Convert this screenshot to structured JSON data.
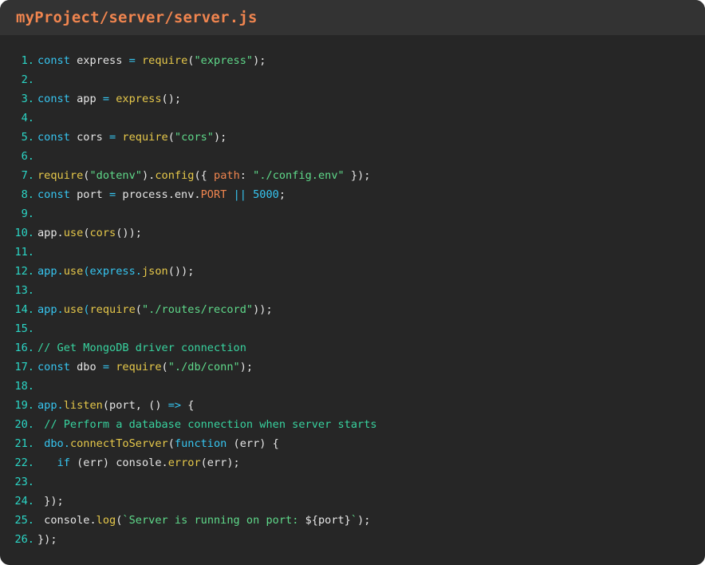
{
  "window": {
    "title": "myProject/server/server.js"
  },
  "colors": {
    "background": "#262626",
    "title_bar": "#333333",
    "title_text": "#f0854f",
    "line_number": "#2bd6c6",
    "keyword": "#36c5f0",
    "function": "#e6c84a",
    "string": "#5fd98a",
    "property": "#f0854f",
    "comment": "#38d39f",
    "default_text": "#e6e6e6"
  },
  "code": {
    "lines": [
      {
        "n": "1.",
        "tokens": [
          [
            "k",
            "const"
          ],
          [
            "d",
            " express "
          ],
          [
            "o",
            "="
          ],
          [
            "d",
            " "
          ],
          [
            "f",
            "require"
          ],
          [
            "d",
            "("
          ],
          [
            "s",
            "\"express\""
          ],
          [
            "d",
            ");"
          ]
        ]
      },
      {
        "n": "2.",
        "tokens": []
      },
      {
        "n": "3.",
        "tokens": [
          [
            "k",
            "const"
          ],
          [
            "d",
            " app "
          ],
          [
            "o",
            "="
          ],
          [
            "d",
            " "
          ],
          [
            "f",
            "express"
          ],
          [
            "d",
            "();"
          ]
        ]
      },
      {
        "n": "4.",
        "tokens": []
      },
      {
        "n": "5.",
        "tokens": [
          [
            "k",
            "const"
          ],
          [
            "d",
            " cors "
          ],
          [
            "o",
            "="
          ],
          [
            "d",
            " "
          ],
          [
            "f",
            "require"
          ],
          [
            "d",
            "("
          ],
          [
            "s",
            "\"cors\""
          ],
          [
            "d",
            ");"
          ]
        ]
      },
      {
        "n": "6.",
        "tokens": []
      },
      {
        "n": "7.",
        "tokens": [
          [
            "f",
            "require"
          ],
          [
            "d",
            "("
          ],
          [
            "s",
            "\"dotenv\""
          ],
          [
            "d",
            ")."
          ],
          [
            "f",
            "config"
          ],
          [
            "d",
            "({ "
          ],
          [
            "p",
            "path"
          ],
          [
            "d",
            ": "
          ],
          [
            "s",
            "\"./config.env\""
          ],
          [
            "d",
            " });"
          ]
        ]
      },
      {
        "n": "8.",
        "tokens": [
          [
            "k",
            "const"
          ],
          [
            "d",
            " port "
          ],
          [
            "o",
            "="
          ],
          [
            "d",
            " process.env."
          ],
          [
            "p",
            "PORT"
          ],
          [
            "d",
            " "
          ],
          [
            "o",
            "||"
          ],
          [
            "d",
            " "
          ],
          [
            "n",
            "5000"
          ],
          [
            "d",
            ";"
          ]
        ]
      },
      {
        "n": "9.",
        "tokens": []
      },
      {
        "n": "10.",
        "tokens": [
          [
            "d",
            "app."
          ],
          [
            "f",
            "use"
          ],
          [
            "d",
            "("
          ],
          [
            "f",
            "cors"
          ],
          [
            "d",
            "());"
          ]
        ]
      },
      {
        "n": "11.",
        "tokens": []
      },
      {
        "n": "12.",
        "tokens": [
          [
            "k",
            "app."
          ],
          [
            "f",
            "use"
          ],
          [
            "k",
            "(express."
          ],
          [
            "f",
            "json"
          ],
          [
            "d",
            "());"
          ]
        ]
      },
      {
        "n": "13.",
        "tokens": []
      },
      {
        "n": "14.",
        "tokens": [
          [
            "k",
            "app."
          ],
          [
            "f",
            "use"
          ],
          [
            "k",
            "("
          ],
          [
            "f",
            "require"
          ],
          [
            "d",
            "("
          ],
          [
            "s",
            "\"./routes/record\""
          ],
          [
            "d",
            "));"
          ]
        ]
      },
      {
        "n": "15.",
        "tokens": []
      },
      {
        "n": "16.",
        "tokens": [
          [
            "c",
            "// Get MongoDB driver connection"
          ]
        ]
      },
      {
        "n": "17.",
        "tokens": [
          [
            "k",
            "const"
          ],
          [
            "d",
            " dbo "
          ],
          [
            "o",
            "="
          ],
          [
            "d",
            " "
          ],
          [
            "f",
            "require"
          ],
          [
            "d",
            "("
          ],
          [
            "s",
            "\"./db/conn\""
          ],
          [
            "d",
            ");"
          ]
        ]
      },
      {
        "n": "18.",
        "tokens": []
      },
      {
        "n": "19.",
        "tokens": [
          [
            "k",
            "app."
          ],
          [
            "f",
            "listen"
          ],
          [
            "d",
            "(port, () "
          ],
          [
            "o",
            "=>"
          ],
          [
            "d",
            " {"
          ]
        ]
      },
      {
        "n": "20.",
        "tokens": [
          [
            "d",
            " "
          ],
          [
            "c",
            "// Perform a database connection when server starts"
          ]
        ]
      },
      {
        "n": "21.",
        "tokens": [
          [
            "d",
            " "
          ],
          [
            "k",
            "dbo."
          ],
          [
            "f",
            "connectToServer"
          ],
          [
            "d",
            "("
          ],
          [
            "k",
            "function"
          ],
          [
            "d",
            " (err) {"
          ]
        ]
      },
      {
        "n": "22.",
        "tokens": [
          [
            "d",
            "   "
          ],
          [
            "k",
            "if"
          ],
          [
            "d",
            " (err) console."
          ],
          [
            "f",
            "error"
          ],
          [
            "d",
            "(err);"
          ]
        ]
      },
      {
        "n": "23.",
        "tokens": []
      },
      {
        "n": "24.",
        "tokens": [
          [
            "d",
            " });"
          ]
        ]
      },
      {
        "n": "25.",
        "tokens": [
          [
            "d",
            " console."
          ],
          [
            "f",
            "log"
          ],
          [
            "d",
            "("
          ],
          [
            "s",
            "`Server is running on port: "
          ],
          [
            "d",
            "${port}"
          ],
          [
            "s",
            "`"
          ],
          [
            "d",
            ");"
          ]
        ]
      },
      {
        "n": "26.",
        "tokens": [
          [
            "d",
            "});"
          ]
        ]
      }
    ]
  }
}
